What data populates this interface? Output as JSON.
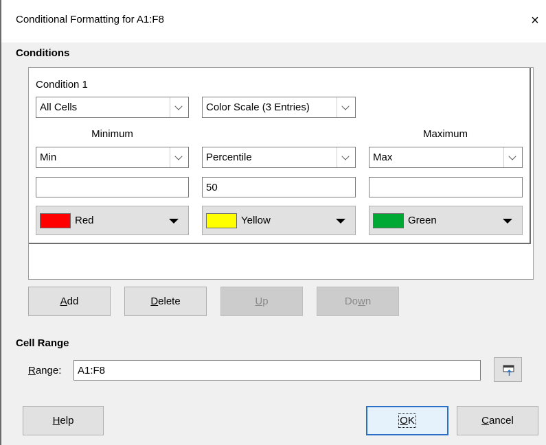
{
  "window": {
    "title": "Conditional Formatting for A1:F8",
    "close_glyph": "×"
  },
  "conditions": {
    "section_label": "Conditions",
    "condition_label": "Condition 1",
    "scope": {
      "value": "All Cells"
    },
    "type": {
      "value": "Color Scale (3 Entries)"
    },
    "minimum": {
      "heading": "Minimum",
      "mode": "Min",
      "value": "",
      "color_name": "Red",
      "color_hex": "#ff0000"
    },
    "middle": {
      "heading": "",
      "mode": "Percentile",
      "value": "50",
      "color_name": "Yellow",
      "color_hex": "#ffff00"
    },
    "maximum": {
      "heading": "Maximum",
      "mode": "Max",
      "value": "",
      "color_name": "Green",
      "color_hex": "#00a933"
    }
  },
  "list_buttons": {
    "add": {
      "mnemonic": "A",
      "rest": "dd"
    },
    "delete": {
      "mnemonic": "D",
      "rest": "elete"
    },
    "up": {
      "mnemonic": "U",
      "rest": "p"
    },
    "down": {
      "pre": "Do",
      "mnemonic": "w",
      "rest": "n"
    }
  },
  "cell_range": {
    "section_label": "Cell Range",
    "range_label": {
      "mnemonic": "R",
      "rest": "ange:"
    },
    "range_value": "A1:F8"
  },
  "dialog_buttons": {
    "help": {
      "mnemonic": "H",
      "rest": "elp"
    },
    "ok": {
      "mnemonic": "O",
      "rest": "K"
    },
    "cancel": {
      "mnemonic": "C",
      "rest": "ancel"
    }
  },
  "icons": {
    "close": "close-icon",
    "dropdown": "chevron-down-icon",
    "color_dropdown": "triangle-down-icon",
    "shrink": "shrink-dialog-icon"
  }
}
